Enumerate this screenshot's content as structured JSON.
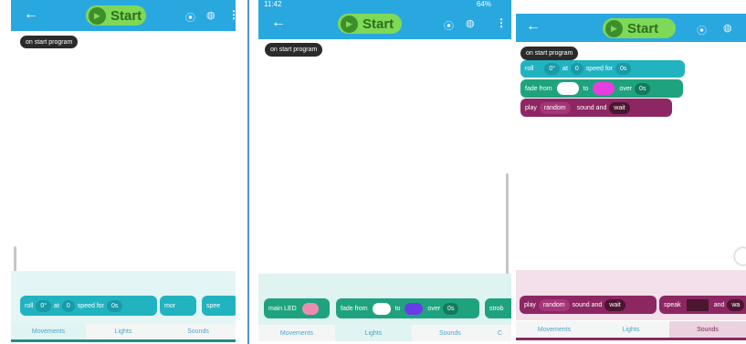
{
  "app": {
    "start_label": "Start",
    "icons": [
      "back-arrow-icon",
      "play-icon",
      "bluetooth-rover-icon",
      "sphero-icon",
      "more-icon"
    ]
  },
  "panel1": {
    "on_start": "on start program",
    "tray_blocks": {
      "roll": "roll",
      "angle": "0°",
      "at": "at",
      "speed": "0",
      "speed_for": "speed for",
      "duration": "0s",
      "partial_1": "mor",
      "partial_2": "spee"
    },
    "tabs": [
      "Movements",
      "Lights",
      "Sounds"
    ],
    "active_tab": "Movements"
  },
  "panel2": {
    "status_time": "11:42",
    "status_battery": "64%",
    "on_start": "on start program",
    "tray_blocks": {
      "main_led": "main LED",
      "fade_from": "fade from",
      "to": "to",
      "over": "over",
      "duration": "0s",
      "partial": "strob"
    },
    "tabs": [
      "Movements",
      "Lights",
      "Sounds",
      "C"
    ],
    "active_tab": "Lights"
  },
  "panel3": {
    "on_start": "on start program",
    "program": {
      "roll": "roll",
      "angle": "0°",
      "at": "at",
      "speed": "0",
      "speed_for": "speed for",
      "duration": "0s",
      "fade_from": "fade from",
      "to": "to",
      "over": "over",
      "fade_duration": "0s",
      "play": "play",
      "random": "random",
      "sound_and": "sound and",
      "wait": "wait"
    },
    "tray_blocks": {
      "play": "play",
      "random": "random",
      "sound_and": "sound and",
      "wait": "wait",
      "speak": "speak",
      "and": "and",
      "partial": "wa"
    },
    "tabs": [
      "Movements",
      "Lights",
      "Sounds"
    ],
    "active_tab": "Sounds"
  },
  "colors": {
    "header": "#29a8e0",
    "start_green": "#7ed957",
    "movement_teal": "#22b3c1",
    "lights_green": "#1fa37f",
    "sound_berry": "#8d2763",
    "fade_start_white": "#ffffff",
    "fade_end_magenta": "#e83ee0",
    "fade_end_purple": "#6a3ce8",
    "main_led_pink": "#f08bb0",
    "speak_dark": "#4a1630"
  }
}
